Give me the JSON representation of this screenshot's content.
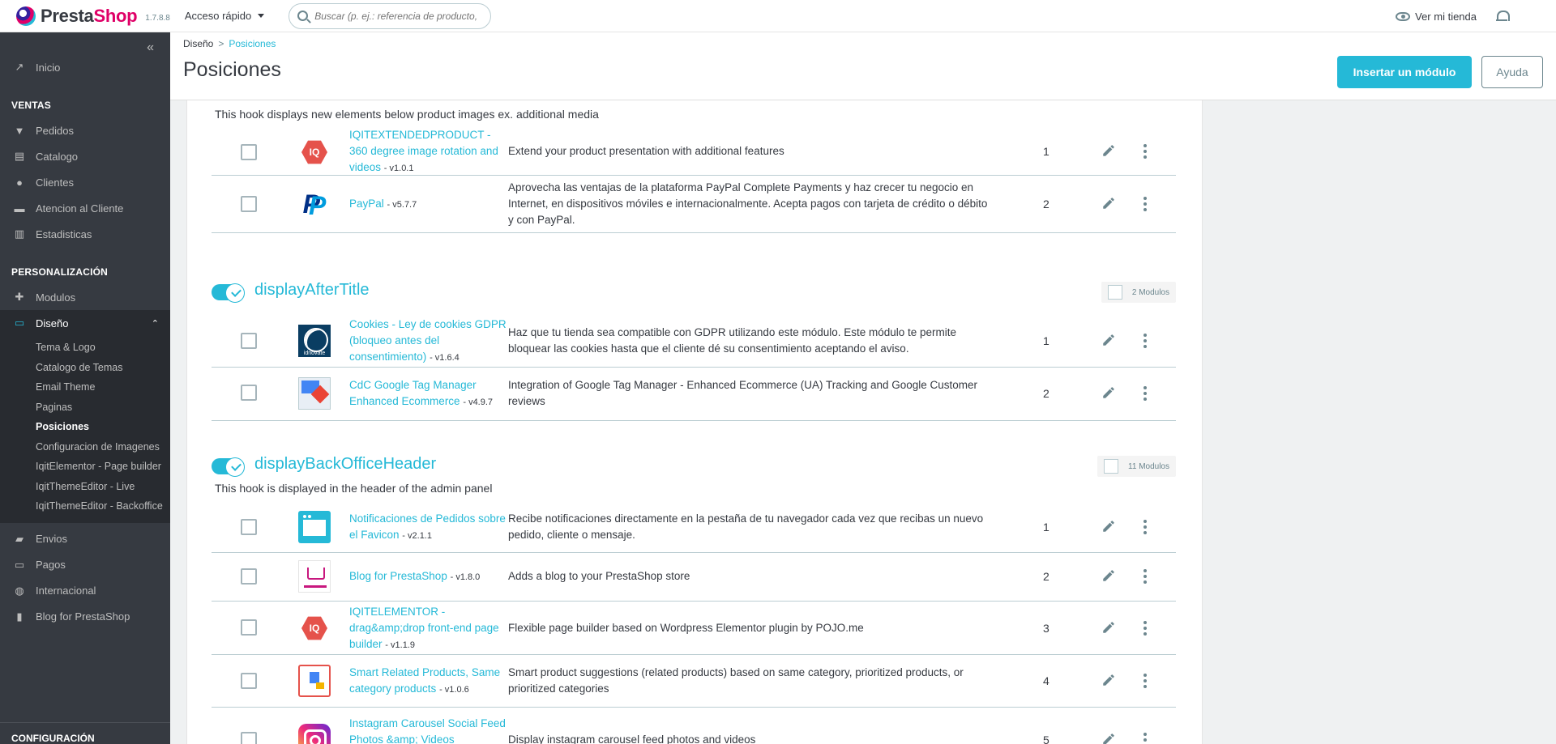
{
  "header": {
    "brand_a": "Presta",
    "brand_b": "Shop",
    "version": "1.7.8.8",
    "quick_access": "Acceso rápido",
    "search_placeholder": "Buscar (p. ej.: referencia de producto,",
    "view_store": "Ver mi tienda"
  },
  "sidebar": {
    "top_items": [
      {
        "label": "Inicio",
        "icon": "trending-up-icon"
      }
    ],
    "sections": [
      {
        "title": "VENTAS",
        "items": [
          {
            "label": "Pedidos",
            "icon": "basket-icon"
          },
          {
            "label": "Catalogo",
            "icon": "store-icon"
          },
          {
            "label": "Clientes",
            "icon": "account-icon"
          },
          {
            "label": "Atencion al Cliente",
            "icon": "chat-icon"
          },
          {
            "label": "Estadisticas",
            "icon": "bar-chart-icon"
          }
        ]
      },
      {
        "title": "PERSONALIZACIÓN",
        "items": [
          {
            "label": "Modulos",
            "icon": "puzzle-icon"
          },
          {
            "label": "Diseño",
            "icon": "desktop-icon",
            "active": true
          }
        ]
      }
    ],
    "sub_items": [
      "Tema & Logo",
      "Catalogo de Temas",
      "Email Theme",
      "Paginas",
      "Posiciones",
      "Configuracion de Imagenes",
      "IqitElementor - Page builder",
      "IqitThemeEditor - Live",
      "IqitThemeEditor - Backoffice"
    ],
    "more_items": [
      {
        "label": "Envios",
        "icon": "truck-icon"
      },
      {
        "label": "Pagos",
        "icon": "card-icon"
      },
      {
        "label": "Internacional",
        "icon": "globe-icon"
      },
      {
        "label": "Blog for PrestaShop",
        "icon": "book-icon"
      }
    ],
    "bottom_section": "CONFIGURACIÓN"
  },
  "page": {
    "breadcrumb_parent": "Diseño",
    "breadcrumb_sep": ">",
    "breadcrumb_current": "Posiciones",
    "title": "Posiciones",
    "insert_button": "Insertar un módulo",
    "help_button": "Ayuda"
  },
  "hooks": [
    {
      "description": "This hook displays new elements below product images ex. additional media",
      "modules": [
        {
          "name": "IQITEXTENDEDPRODUCT - 360 degree image rotation and videos",
          "version": "- v1.0.1",
          "description": "Extend your product presentation with additional features",
          "position": "1",
          "logo": "iqit-logo"
        },
        {
          "name": "PayPal",
          "version": "- v5.7.7",
          "description": "Aprovecha las ventajas de la plataforma PayPal Complete Payments y haz crecer tu negocio en Internet, en dispositivos móviles e internacionalmente. Acepta pagos con tarjeta de crédito o débito y con PayPal.",
          "position": "2",
          "logo": "paypal-logo"
        }
      ]
    },
    {
      "name": "displayAfterTitle",
      "count": "2 Modulos",
      "modules": [
        {
          "name": "Cookies - Ley de cookies GDPR (bloqueo antes del consentimiento)",
          "version": "- v1.6.4",
          "description": "Haz que tu tienda sea compatible con GDPR utilizando este módulo. Este módulo te permite bloquear las cookies hasta que el cliente dé su consentimiento aceptando el aviso.",
          "position": "1",
          "logo": "idnovate-logo",
          "logo_text": "idnovate"
        },
        {
          "name": "CdC Google Tag Manager Enhanced Ecommerce",
          "version": "- v4.9.7",
          "description": "Integration of Google Tag Manager - Enhanced Ecommerce (UA) Tracking and Google Customer reviews",
          "position": "2",
          "logo": "gtm-logo"
        }
      ]
    },
    {
      "name": "displayBackOfficeHeader",
      "count": "11 Modulos",
      "description": "This hook is displayed in the header of the admin panel",
      "modules": [
        {
          "name": "Notificaciones de Pedidos sobre el Favicon",
          "version": "- v2.1.1",
          "description": "Recibe notificaciones directamente en la pestaña de tu navegador cada vez que recibas un nuevo pedido, cliente o mensaje.",
          "position": "1",
          "logo": "notification-logo"
        },
        {
          "name": "Blog for PrestaShop",
          "version": "- v1.8.0",
          "description": "Adds a blog to your PrestaShop store",
          "position": "2",
          "logo": "blog-logo"
        },
        {
          "name": "IQITELEMENTOR - drag&amp;drop front-end page builder",
          "version": "- v1.1.9",
          "description": "Flexible page builder based on Wordpress Elementor plugin by POJO.me",
          "position": "3",
          "logo": "iqit-logo"
        },
        {
          "name": "Smart Related Products, Same category products",
          "version": "- v1.0.6",
          "description": "Smart product suggestions (related products) based on same category, prioritized products, or prioritized categories",
          "position": "4",
          "logo": "smart-related-logo"
        },
        {
          "name": "Instagram Carousel Social Feed Photos &amp; Videos",
          "version": "",
          "description": "Display instagram carousel feed photos and videos",
          "position": "5",
          "logo": "instagram-logo"
        }
      ]
    }
  ],
  "colors": {
    "accent": "#25b9d7",
    "sidebar": "#363a41",
    "text": "#363a41"
  }
}
